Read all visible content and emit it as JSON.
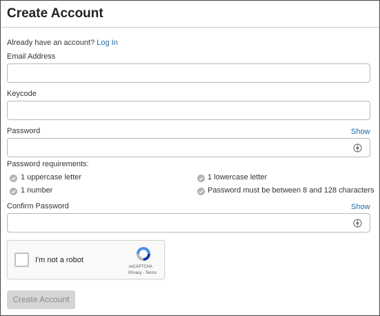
{
  "header": {
    "title": "Create Account"
  },
  "login_prompt": {
    "text": "Already have an account?",
    "link": "Log In"
  },
  "email": {
    "label": "Email Address",
    "value": "",
    "placeholder": ""
  },
  "keycode": {
    "label": "Keycode",
    "value": "",
    "placeholder": ""
  },
  "password": {
    "label": "Password",
    "show_label": "Show",
    "value": ""
  },
  "requirements": {
    "heading": "Password requirements:",
    "items": [
      "1 uppercase letter",
      "1 lowercase letter",
      "1 number",
      "Password must be between 8 and 128 characters"
    ]
  },
  "confirm_password": {
    "label": "Confirm Password",
    "show_label": "Show",
    "value": ""
  },
  "captcha": {
    "label": "I'm not a robot",
    "brand": "reCAPTCHA",
    "privacy": "Privacy",
    "separator": " - ",
    "terms": "Terms"
  },
  "submit": {
    "label": "Create Account"
  },
  "colors": {
    "link": "#1a66a8",
    "button_disabled_bg": "#d5d5d5",
    "button_disabled_text": "#8a8a8a",
    "check_icon": "#b3b3b3"
  },
  "icons": {
    "password_toggle": "eye-icon",
    "requirement": "check-circle-icon",
    "captcha": "recaptcha-logo-icon"
  }
}
